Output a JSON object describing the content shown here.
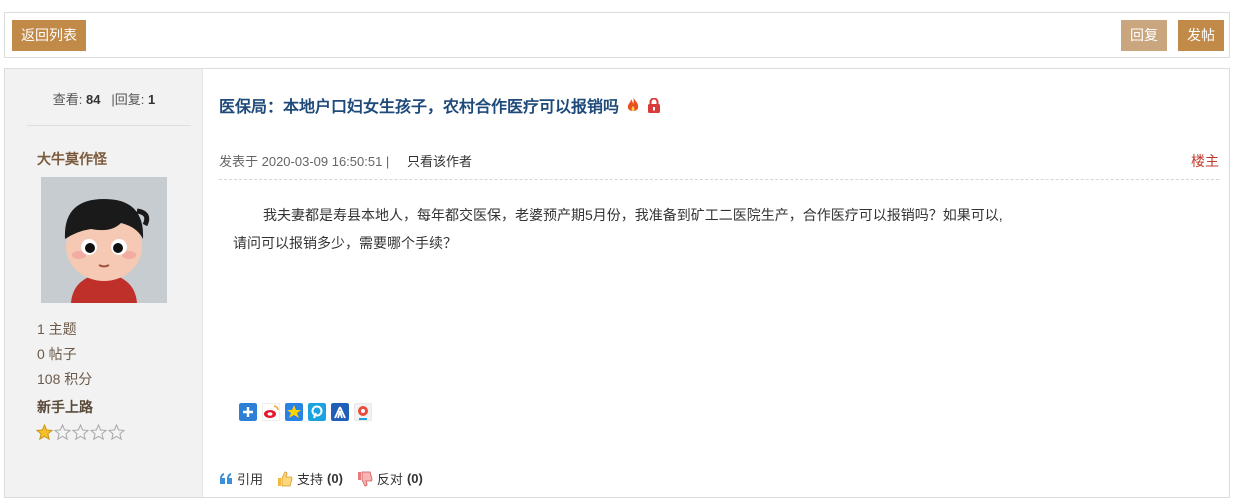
{
  "toolbar": {
    "back_label": "返回列表",
    "reply_label": "回复",
    "post_label": "发帖"
  },
  "thread": {
    "views_label": "查看:",
    "views": "84",
    "replies_label": "|回复:",
    "replies": "1",
    "title": "医保局：本地户口妇女生孩子，农村合作医疗可以报销吗",
    "icons": [
      "hot-fire-icon",
      "lock-icon"
    ]
  },
  "author": {
    "name": "大牛莫作怪",
    "avatar": "cartoon-avatar-icon",
    "topics": "1 主题",
    "posts": "0 帖子",
    "points": "108 积分",
    "level": "新手上路",
    "stars": 1,
    "stars_total": 5
  },
  "post": {
    "posted_at": "发表于 2020-03-09 16:50:51 |",
    "only_author": "只看该作者",
    "floor": "楼主",
    "line1": "我夫妻都是寿县本地人，每年都交医保，老婆预产期5月份，我准备到矿工二医院生产，合作医疗可以报销吗？如果可以,",
    "line2": "请问可以报销多少，需要哪个手续？"
  },
  "share_icons": [
    "share-more-icon",
    "weibo-icon",
    "qzone-icon",
    "tencent-weibo-icon",
    "renren-icon",
    "tencent-friend-icon"
  ],
  "actions": {
    "quote": "引用",
    "support_label": "支持",
    "support_count": "(0)",
    "oppose_label": "反对",
    "oppose_count": "(0)"
  },
  "colors": {
    "brand": "#c28a48",
    "title": "#1e4a7a",
    "floor": "#c0392b"
  }
}
